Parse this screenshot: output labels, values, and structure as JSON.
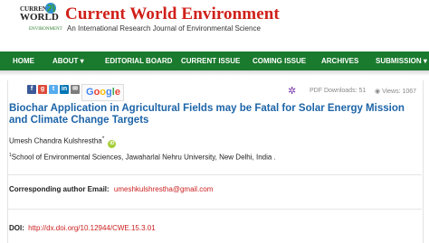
{
  "header": {
    "logo": {
      "line1": "CURRENT",
      "line2": "WORLD",
      "line3": "ENVIRONMENT"
    },
    "title": "Current World Environment",
    "subtitle": "An International Research Journal of Environmental Science",
    "title_color": "#d0201a"
  },
  "nav": {
    "color": "#1a7a2e",
    "items": [
      {
        "label": "HOME"
      },
      {
        "label": "ABOUT ▾"
      },
      {
        "label": "EDITORIAL BOARD"
      },
      {
        "label": "CURRENT ISSUE"
      },
      {
        "label": "COMING ISSUE"
      },
      {
        "label": "ARCHIVES"
      },
      {
        "label": "SUBMISSION ▾"
      }
    ]
  },
  "share": {
    "icons": [
      {
        "name": "facebook-icon",
        "glyph": "f",
        "color": "#3b5998"
      },
      {
        "name": "google-plus-icon",
        "glyph": "g",
        "color": "#dd4b39"
      },
      {
        "name": "twitter-icon",
        "glyph": "t",
        "color": "#55acee"
      },
      {
        "name": "linkedin-icon",
        "glyph": "in",
        "color": "#0077b5"
      },
      {
        "name": "email-icon",
        "glyph": "✉",
        "color": "#7d7d7d"
      }
    ],
    "google_letters": [
      "G",
      "o",
      "o",
      "g",
      "l",
      "e"
    ],
    "google_colors": [
      "#4285f4",
      "#ea4335",
      "#fbbc05",
      "#4285f4",
      "#34a853",
      "#ea4335"
    ]
  },
  "stats": {
    "pdf_downloads": "PDF Downloads: 51",
    "views": "Views: 1067"
  },
  "article": {
    "title": "Biochar Application in Agricultural Fields may be Fatal for Solar Energy Mission and Climate Change Targets",
    "author": "Umesh Chandra Kulshrestha",
    "author_sup": "*",
    "affiliation_sup": "1",
    "affiliation": "School of Environmental Sciences, Jawaharlal Nehru University, New Delhi, India ."
  },
  "corresponding": {
    "label": "Corresponding author Email:",
    "email": "umeshkulshrestha@gmail.com"
  },
  "doi": {
    "label": "DOI:",
    "link": "http://dx.doi.org/10.12944/CWE.15.3.01"
  }
}
